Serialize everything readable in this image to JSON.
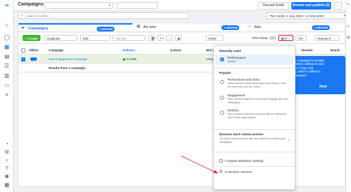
{
  "topbar": {
    "title": "Campaigns",
    "search_placeholder": "Search and filter",
    "discard_label": "Discard Drafts",
    "review_label": "Review and publish (3)",
    "date_range": "This month: 1 Sep 2023 - 14 Sep 2023"
  },
  "tabs": {
    "campaigns": "Campaigns",
    "campaigns_selected": "1 selected",
    "ad_sets": "Ad sets",
    "ad_sets_selected": "1 selected",
    "ads": "Ads",
    "ads_selected": "1 selected"
  },
  "toolbar": {
    "create": "+ Create",
    "duplicate": "Duplicate",
    "edit": "Edit",
    "ab_test": "A/B test",
    "rules": "Rules",
    "view_setup": "View Setup",
    "reports": "Reports"
  },
  "table": {
    "headers": [
      "Off/On",
      "Campaign",
      "Delivery ↑",
      "Actions",
      "Bid st",
      "Results",
      "Reach"
    ],
    "row": {
      "campaign": "New Engagement campaign",
      "delivery": "In draft",
      "bid": "Using"
    },
    "summary": "Results from 1 campaign"
  },
  "dropdown": {
    "recently_used": "Recently used",
    "performance": "Performance",
    "performance_sub": "Default",
    "popular": "Popular",
    "performance_clicks": "Performance and clicks",
    "performance_clicks_sub": "View common performance and click metrics, such as reach and cost per result.",
    "engagement": "Engagement",
    "engagement_sub": "View metrics related to how people engage with your campaigns.",
    "delivery": "Delivery",
    "delivery_sub": "View metrics related to how your ads are delivered and to how many people.",
    "discover": "Discover more column presets",
    "discover_sub": "Try other column presets with key metrics to monitor your campaigns.",
    "compare": "Compare attribution settings",
    "customise": "Customise columns"
  },
  "popover": {
    "text": "ion campaign for people ... Metric attribution and 1- or 7-day click ing, which is different adNetwork.",
    "line1": "ion campaign for people",
    "line2": "... Metric attribution and",
    "line3": "1- or 7-day click",
    "line4": "ing, which is different",
    "line5": "adNetwork.",
    "next": "Next"
  },
  "colors": {
    "accent": "#1877f2",
    "highlight_red": "#e02020",
    "row_selected": "#eaf3e2",
    "draft_green": "#42b72a"
  }
}
